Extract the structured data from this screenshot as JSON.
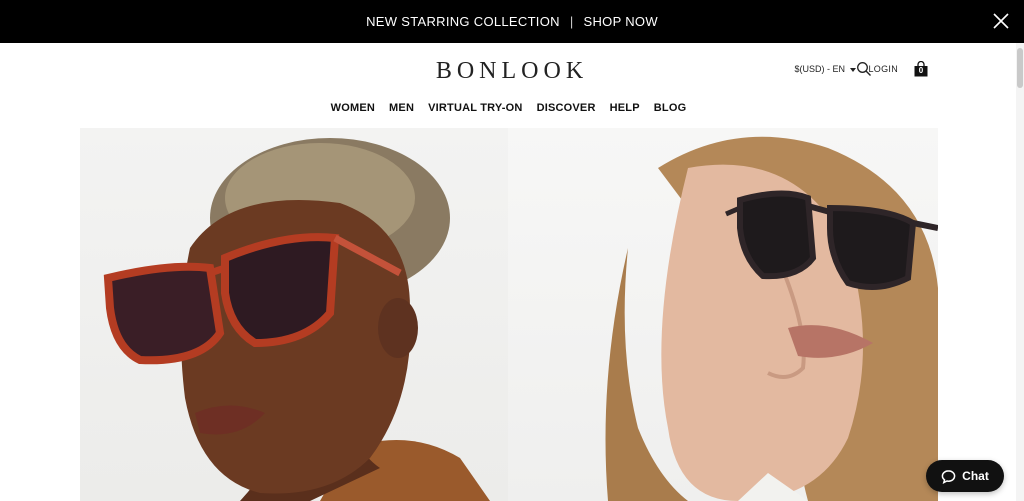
{
  "promo": {
    "left_text": "NEW STARRING COLLECTION",
    "separator": "|",
    "right_text": "SHOP NOW",
    "close_icon": "close-icon"
  },
  "header": {
    "logo": "BONLOOK",
    "search_icon": "search-icon",
    "currency": "$(USD) - EN",
    "login": "LOGIN",
    "cart_icon": "shopping-bag-icon",
    "cart_count": "0"
  },
  "nav": {
    "items": [
      "WOMEN",
      "MEN",
      "VIRTUAL TRY-ON",
      "DISCOVER",
      "HELP",
      "BLOG"
    ]
  },
  "chat": {
    "label": "Chat",
    "icon": "chat-bubble-icon"
  },
  "colors": {
    "promo_bg": "#000000",
    "chat_bg": "#111111",
    "frame_red": "#b43c22",
    "frame_dark": "#2e2528"
  }
}
